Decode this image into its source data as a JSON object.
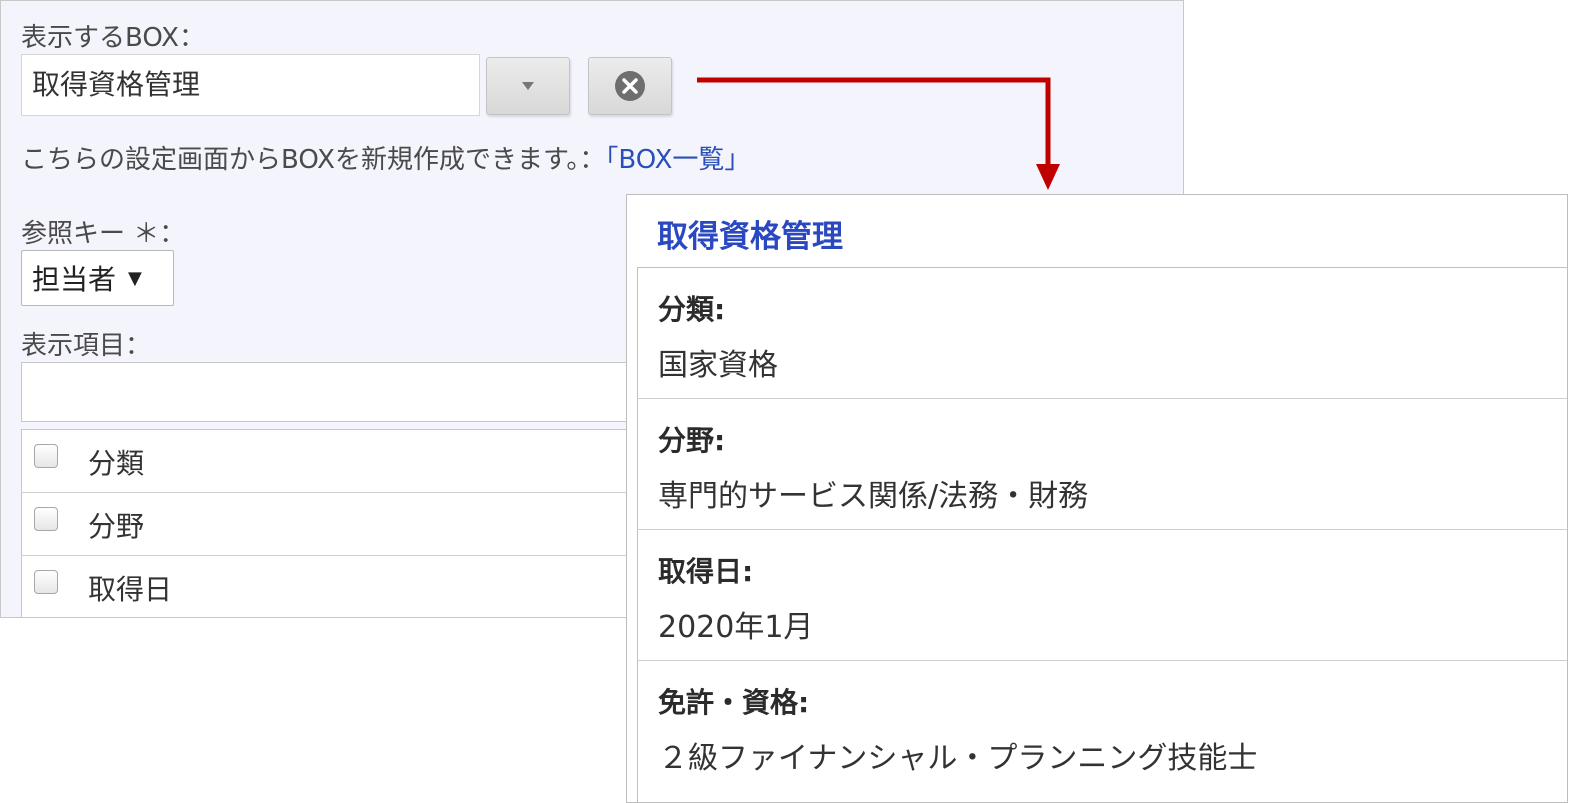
{
  "settings": {
    "box_label": "表示するBOX：",
    "box_value": "取得資格管理",
    "help_text": "こちらの設定画面からBOXを新規作成できます。：",
    "help_link": "「BOX一覧」",
    "ref_key_label": "参照キー ＊：",
    "ref_key_value": "担当者",
    "display_items_label": "表示項目：",
    "items": [
      {
        "label": "分類"
      },
      {
        "label": "分野"
      },
      {
        "label": "取得日"
      }
    ]
  },
  "preview": {
    "title": "取得資格管理",
    "fields": [
      {
        "label": "分類:",
        "value": "国家資格"
      },
      {
        "label": "分野:",
        "value": "専門的サービス関係/法務・財務"
      },
      {
        "label": "取得日:",
        "value": "2020年1月"
      },
      {
        "label": "免許・資格:",
        "value": "２級ファイナンシャル・プランニング技能士"
      }
    ]
  },
  "colors": {
    "panel_bg": "#f4f4fd",
    "link": "#2b4fb8",
    "title": "#2a48c0",
    "arrow": "#c00000"
  },
  "icons": {
    "dropdown": "chevron-down-icon",
    "clear": "clear-circle-icon",
    "select_caret": "caret-down-icon",
    "arrow": "connector-arrow-icon"
  }
}
